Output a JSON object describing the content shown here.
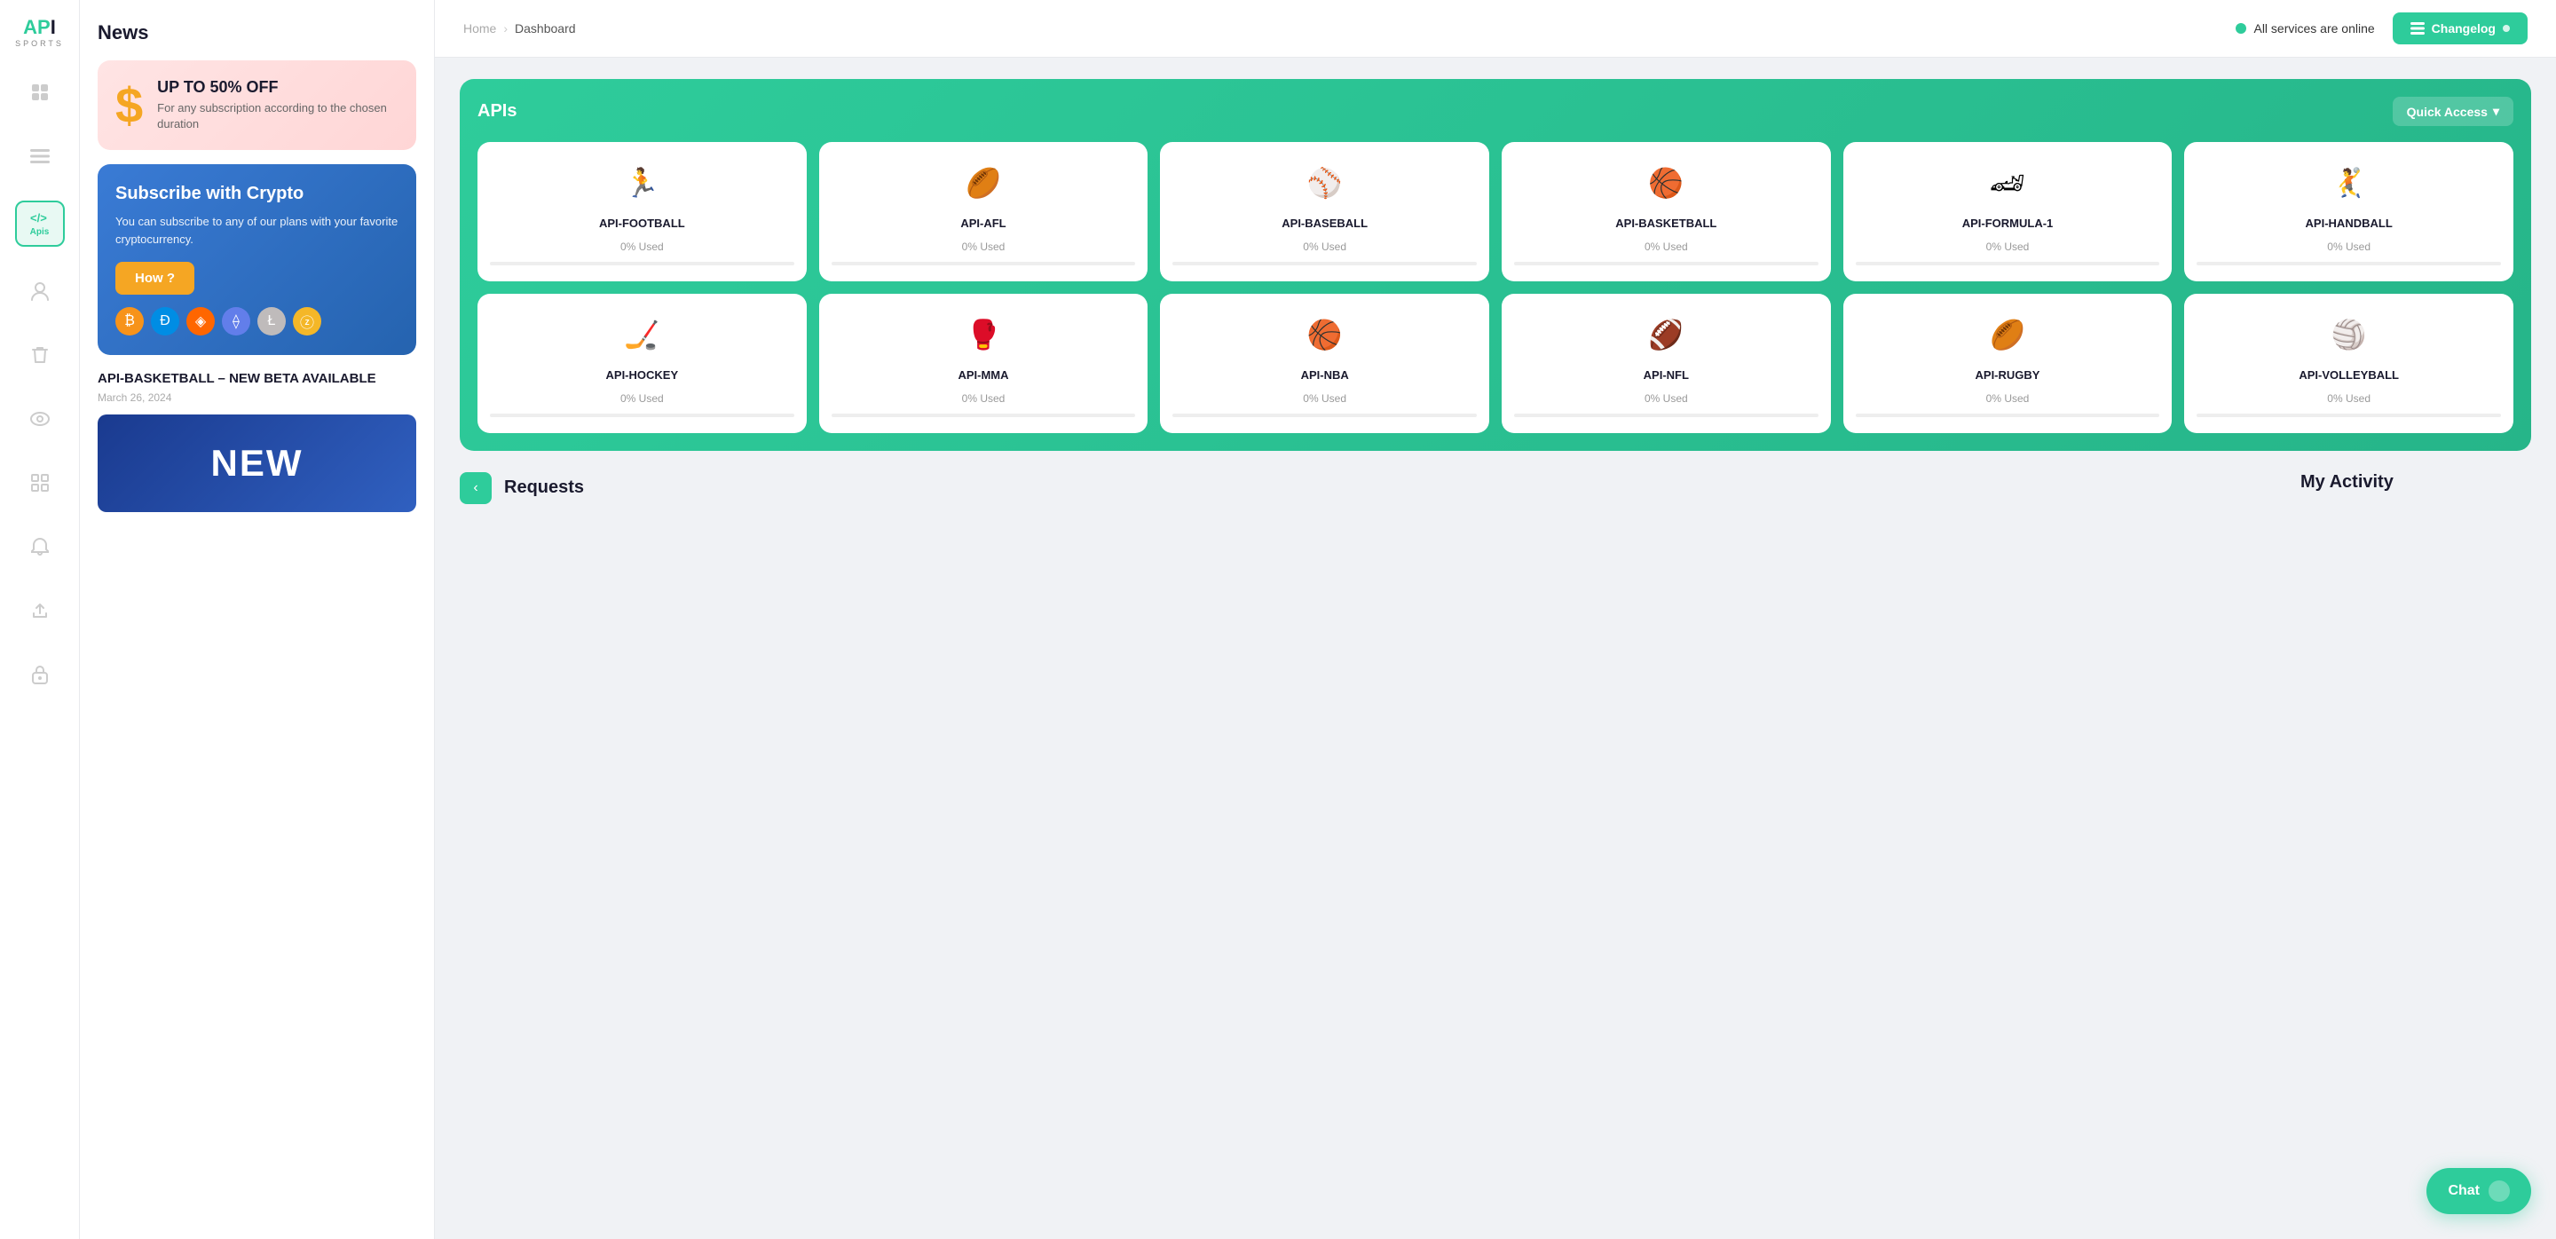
{
  "logo": {
    "text": "API",
    "sub": "SPORTS"
  },
  "sidebar": {
    "icons": [
      {
        "name": "dashboard-icon",
        "symbol": "⊞",
        "active": false
      },
      {
        "name": "list-icon",
        "symbol": "☰",
        "active": false
      },
      {
        "name": "code-icon",
        "symbol": "</>",
        "active": true,
        "label": "Apis"
      },
      {
        "name": "user-icon",
        "symbol": "👤",
        "active": false
      },
      {
        "name": "trash-icon",
        "symbol": "🗑",
        "active": false
      },
      {
        "name": "eye-icon",
        "symbol": "👁",
        "active": false
      },
      {
        "name": "grid-icon",
        "symbol": "⊞",
        "active": false
      },
      {
        "name": "bell-icon",
        "symbol": "🔔",
        "active": false
      },
      {
        "name": "export-icon",
        "symbol": "↗",
        "active": false
      },
      {
        "name": "lock-icon",
        "symbol": "🔒",
        "active": false
      }
    ]
  },
  "news": {
    "title": "News",
    "promo_sale": {
      "dollar": "$",
      "heading": "UP TO 50% OFF",
      "body": "For any subscription according to the chosen duration"
    },
    "promo_crypto": {
      "heading": "Subscribe with Crypto",
      "body": "You can subscribe to any of our plans with your favorite cryptocurrency.",
      "button": "How ?"
    },
    "article": {
      "heading": "API-BASKETBALL – NEW BETA AVAILABLE",
      "date": "March 26, 2024",
      "thumb_text": "NEW"
    }
  },
  "topbar": {
    "breadcrumb_home": "Home",
    "breadcrumb_sep": "›",
    "breadcrumb_current": "Dashboard",
    "status_text": "All services are online",
    "changelog_label": "Changelog"
  },
  "apis_section": {
    "label": "APIs",
    "quick_access": "Quick Access",
    "cards_row1": [
      {
        "name": "API-FOOTBALL",
        "used": "0% Used",
        "icon": "🏃",
        "fill": 0
      },
      {
        "name": "API-AFL",
        "used": "0% Used",
        "icon": "🏉",
        "fill": 0
      },
      {
        "name": "API-BASEBALL",
        "used": "0% Used",
        "icon": "⚾",
        "fill": 0
      },
      {
        "name": "API-BASKETBALL",
        "used": "0% Used",
        "icon": "🏀",
        "fill": 0
      },
      {
        "name": "API-FORMULA-1",
        "used": "0% Used",
        "icon": "🏎",
        "fill": 0
      },
      {
        "name": "API-HANDBALL",
        "used": "0% Used",
        "icon": "🤾",
        "fill": 0
      }
    ],
    "cards_row2": [
      {
        "name": "API-HOCKEY",
        "used": "0% Used",
        "icon": "🏒",
        "fill": 0
      },
      {
        "name": "API-MMA",
        "used": "0% Used",
        "icon": "🥊",
        "fill": 0
      },
      {
        "name": "API-NBA",
        "used": "0% Used",
        "icon": "🏀",
        "fill": 0
      },
      {
        "name": "API-NFL",
        "used": "0% Used",
        "icon": "🏈",
        "fill": 0
      },
      {
        "name": "API-RUGBY",
        "used": "0% Used",
        "icon": "🏉",
        "fill": 0
      },
      {
        "name": "API-VOLLEYBALL",
        "used": "0% Used",
        "icon": "🏐",
        "fill": 0
      }
    ]
  },
  "bottom": {
    "requests_label": "Requests",
    "activity_label": "My Activity"
  },
  "chat": {
    "label": "Chat"
  },
  "apis_tooltip": "Apis"
}
